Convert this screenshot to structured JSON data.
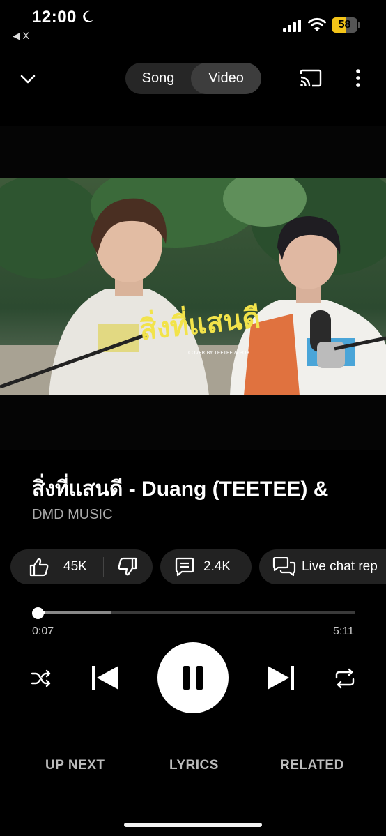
{
  "status_bar": {
    "time": "12:00",
    "back_app": "◀ X",
    "battery_level": "58",
    "battery_percent": 58,
    "battery_color": "#f4c418",
    "icons": [
      "moon-icon",
      "signal-icon",
      "wifi-icon",
      "battery-icon"
    ]
  },
  "header": {
    "toggle": {
      "song_label": "Song",
      "video_label": "Video",
      "selected": "Video"
    },
    "icons": [
      "chevron-down-icon",
      "cast-icon",
      "more-vertical-icon"
    ]
  },
  "video": {
    "overlay_title": "สิ่งที่แสนดี",
    "overlay_subtitle": "COVER BY TEETEE & POR"
  },
  "track": {
    "title": "สิ่งที่แสนดี - Duang (TEETEE) &",
    "artist": "DMD MUSIC"
  },
  "actions": {
    "likes": "45K",
    "comments": "2.4K",
    "live_chat": "Live chat rep"
  },
  "progress": {
    "current": "0:07",
    "total": "5:11",
    "played_fraction": 0.022,
    "buffered_fraction": 0.23
  },
  "controls": {
    "state": "playing",
    "icons": [
      "shuffle-icon",
      "previous-icon",
      "pause-icon",
      "next-icon",
      "repeat-icon"
    ]
  },
  "tabs": {
    "up_next": "UP NEXT",
    "lyrics": "LYRICS",
    "related": "RELATED"
  },
  "colors": {
    "background": "#000000",
    "pill": "#222222",
    "overlay_yellow": "#f2e34a"
  }
}
